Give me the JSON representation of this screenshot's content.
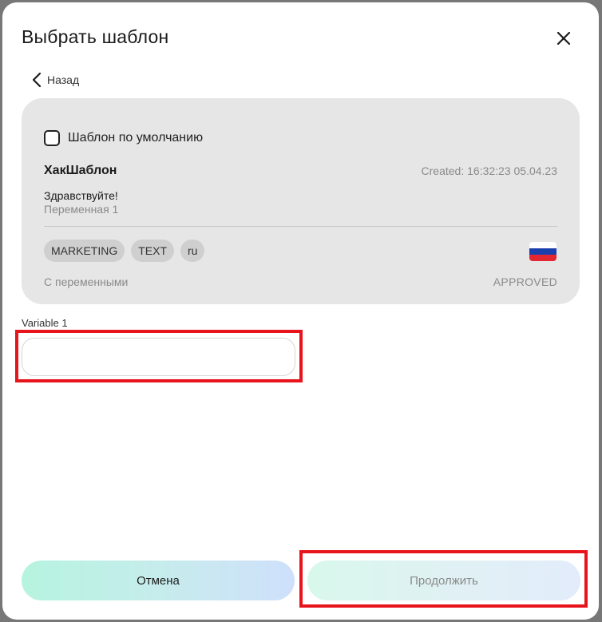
{
  "modal": {
    "title": "Выбрать шаблон",
    "back_label": "Назад"
  },
  "card": {
    "default_checkbox_label": "Шаблон по умолчанию",
    "default_checked": false,
    "template_name": "ХакШаблон",
    "created": "Created: 16:32:23 05.04.23",
    "body_text": "Здравствуйте!",
    "body_variable": "Переменная 1",
    "tags": [
      "MARKETING",
      "TEXT",
      "ru"
    ],
    "note": "С переменными",
    "status": "APPROVED",
    "flag_colors": [
      "#ffffff",
      "#1c3fae",
      "#e3262f"
    ]
  },
  "variable": {
    "label": "Variable 1",
    "value": ""
  },
  "buttons": {
    "cancel": "Отмена",
    "continue": "Продолжить"
  },
  "highlight_color": "#e8141b"
}
